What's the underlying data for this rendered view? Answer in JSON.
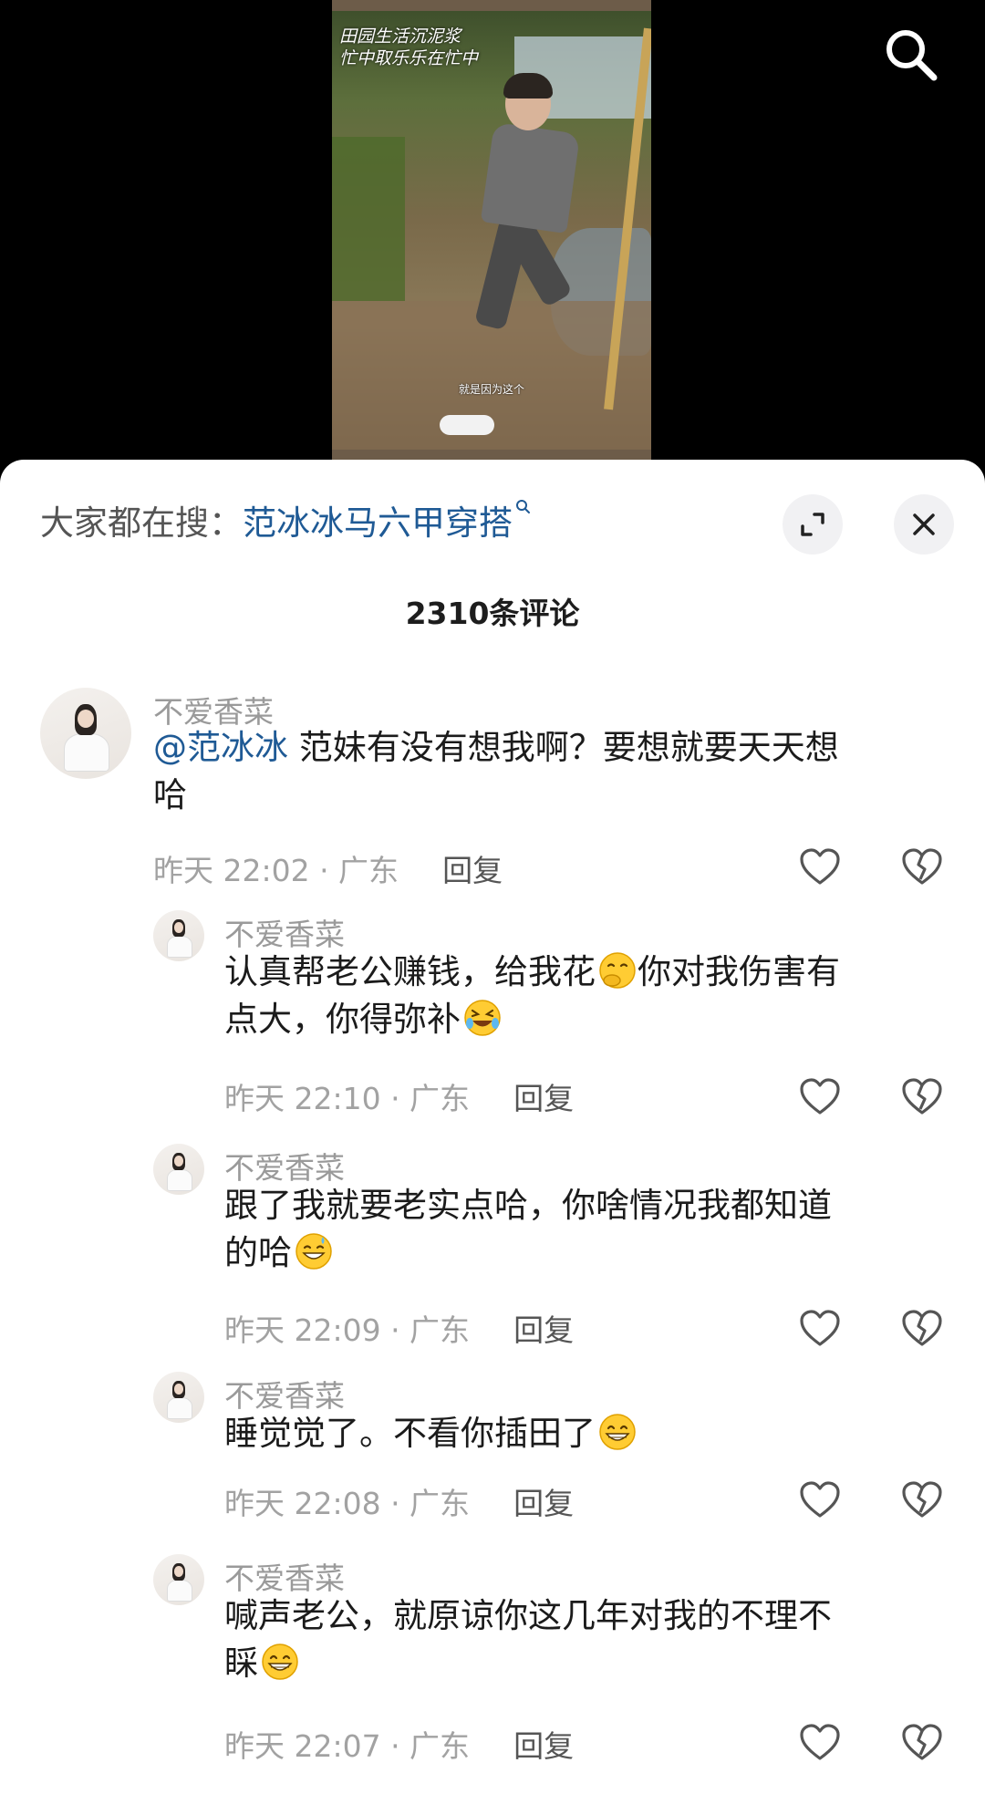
{
  "video": {
    "overlay_line1": "田园生活沉泥浆",
    "overlay_line2": "忙中取乐乐在忙中",
    "caption": "就是因为这个"
  },
  "sheet": {
    "search_prefix": "大家都在搜：",
    "search_term": "范冰冰马六甲穿搭",
    "comment_count": "2310条评论"
  },
  "comments": [
    {
      "username": "不爱香菜",
      "mention": "@范冰冰",
      "text_line1": " 范妹有没有想我啊？要想就要天天想",
      "text_line2": "哈",
      "time": "昨天 22:02 · 广东",
      "reply": "回复",
      "emoji": ""
    },
    {
      "username": "不爱香菜",
      "text_line1a": "认真帮老公赚钱，给我花",
      "emoji1": "hand-over-mouth",
      "text_line1b": "你对我伤害有",
      "text_line2": "点大，你得弥补",
      "emoji2": "rolling-laughing",
      "time": "昨天 22:10 · 广东",
      "reply": "回复"
    },
    {
      "username": "不爱香菜",
      "text_line1": "跟了我就要老实点哈，你啥情况我都知道",
      "text_line2": "的哈",
      "emoji": "grinning-sweat",
      "time": "昨天 22:09 · 广东",
      "reply": "回复"
    },
    {
      "username": "不爱香菜",
      "text_line1": "睡觉觉了。不看你插田了",
      "emoji": "beaming-grin",
      "time": "昨天 22:08 · 广东",
      "reply": "回复"
    },
    {
      "username": "不爱香菜",
      "text_line1": "喊声老公，就原谅你这几年对我的不理不",
      "text_line2": "睬",
      "emoji": "beaming-grin",
      "time": "昨天 22:07 · 广东",
      "reply": "回复"
    }
  ],
  "colors": {
    "link": "#1f5a95",
    "meta": "#a2a2a2",
    "sheet_bg": "#ffffff"
  }
}
